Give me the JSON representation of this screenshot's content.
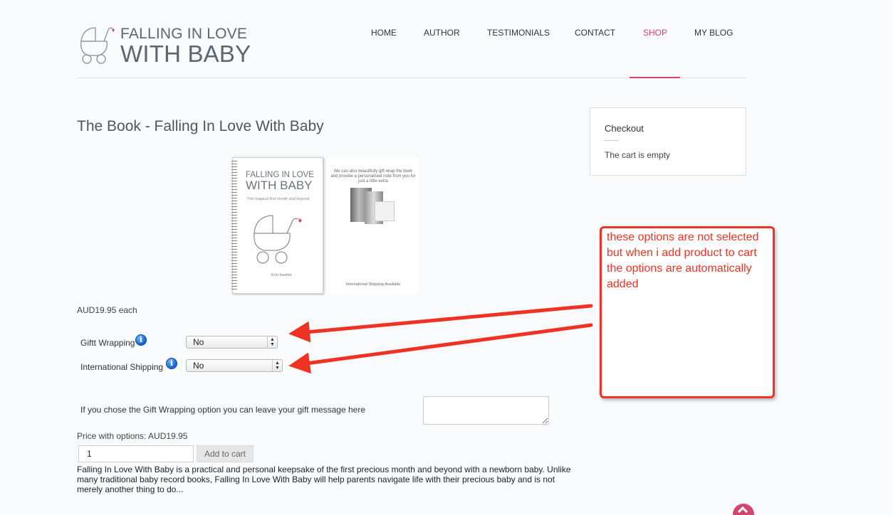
{
  "header": {
    "logo_line1": "FALLING IN LOVE",
    "logo_line2": "WITH BABY",
    "nav": [
      {
        "label": "HOME",
        "active": false
      },
      {
        "label": "AUTHOR",
        "active": false
      },
      {
        "label": "TESTIMONIALS",
        "active": false
      },
      {
        "label": "CONTACT",
        "active": false
      },
      {
        "label": "SHOP",
        "active": true
      },
      {
        "label": "MY BLOG",
        "active": false
      }
    ],
    "accent_color": "#d1466f"
  },
  "product": {
    "title": "The Book - Falling In Love With Baby",
    "book_cover": {
      "line1": "FALLING IN LOVE",
      "line2": "WITH BABY",
      "subtitle": "The magical first month and beyond",
      "author": "Erin Sexton"
    },
    "gift_image": {
      "text": "We can also beautifully gift wrap the book and provide a personalised note from you for just a little extra",
      "footer": "International Shipping Available"
    },
    "price_each": "AUD19.95 each",
    "options": [
      {
        "label": "Giftt Wrapping",
        "value": "No"
      },
      {
        "label": "International Shipping",
        "value": "No"
      }
    ],
    "gift_message_label": "If you chose the Gift Wrapping option you can leave your gift message here",
    "gift_message_value": "",
    "price_with_options": "Price with options: AUD19.95",
    "quantity": "1",
    "add_to_cart": "Add to cart",
    "description": "Falling In Love With Baby is a practical and personal keepsake of the first precious month and beyond with a newborn baby. Unlike many traditional baby record books, Falling In Love With Baby will help parents navigate life with their precious baby and is not merely another thing to do..."
  },
  "sidebar": {
    "checkout_title": "Checkout",
    "cart_status": "The cart is empty"
  },
  "annotation": {
    "text": "these options are not selected but when i add product to cart the options are automatically added",
    "color": "#ee3324"
  }
}
